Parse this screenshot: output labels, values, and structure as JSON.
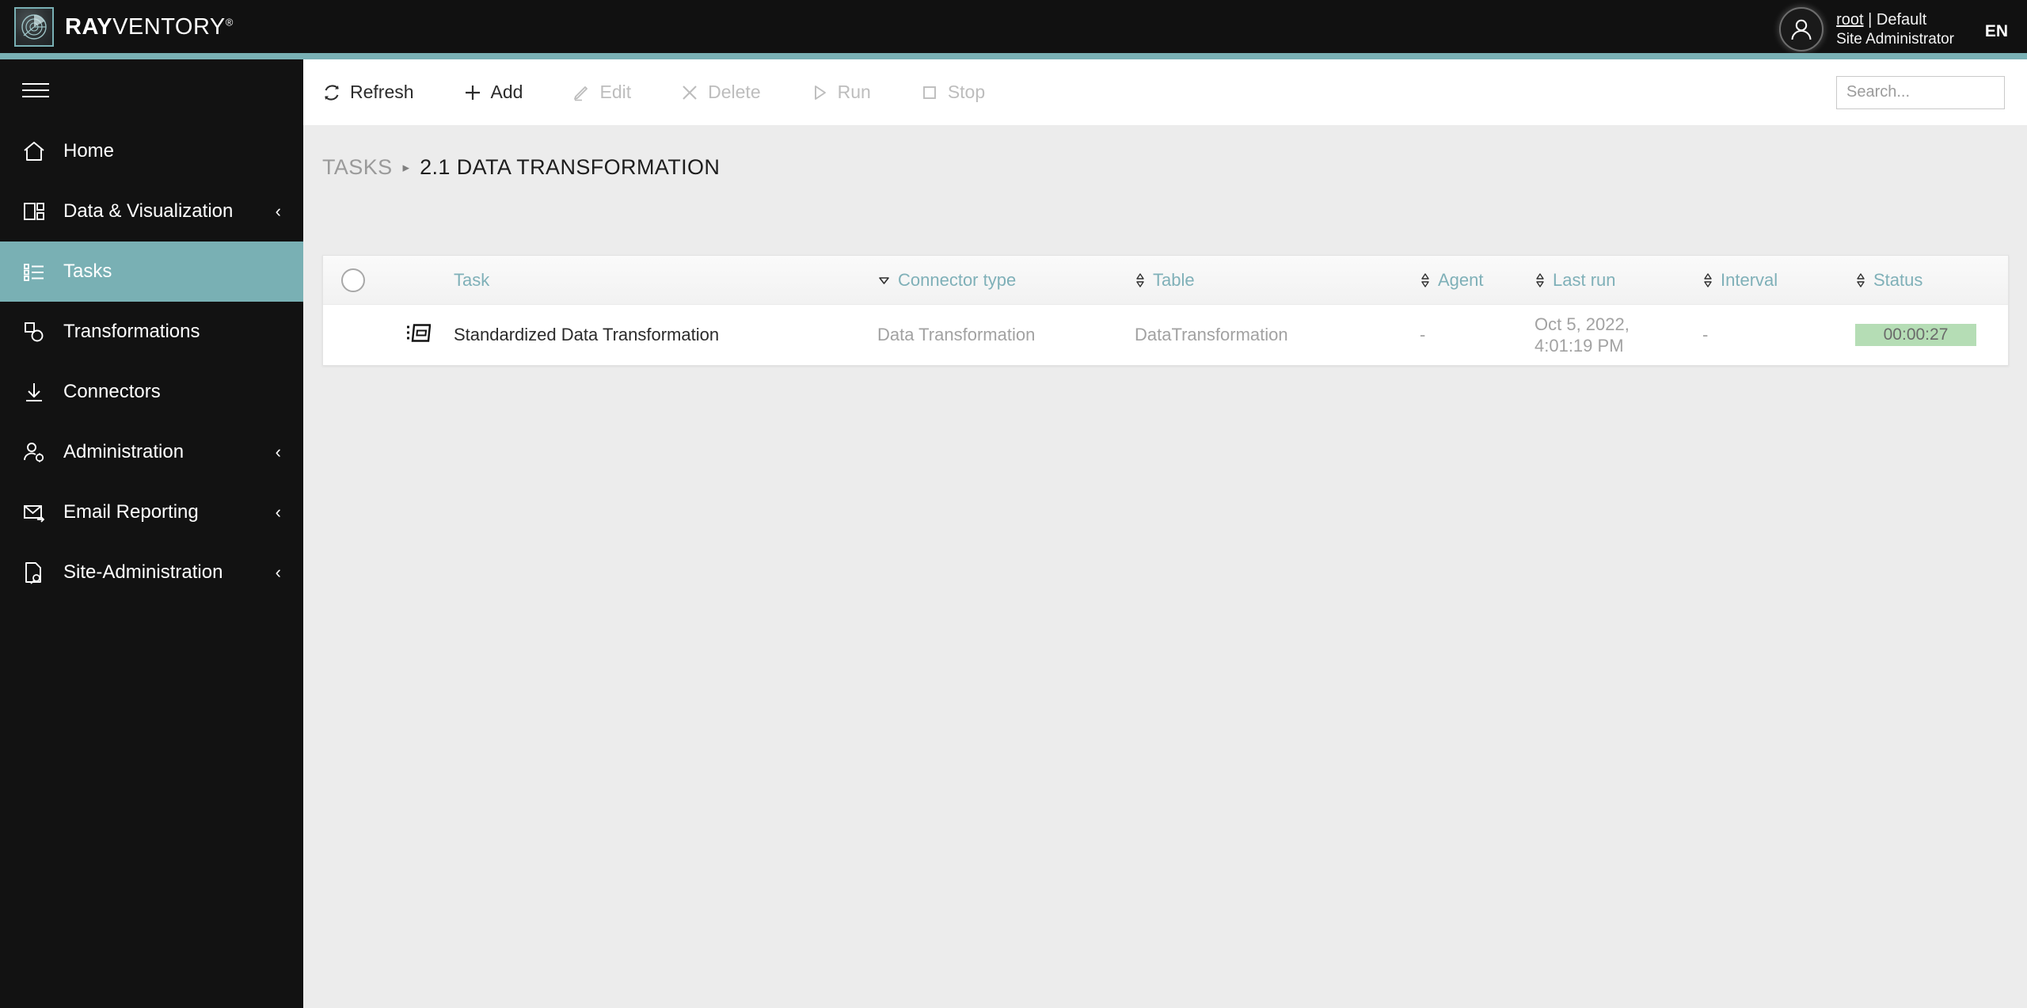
{
  "app": {
    "brand_bold": "RAY",
    "brand_light": "VENTORY",
    "brand_reg": "®",
    "logo_icon": "radar-icon",
    "accent_color": "#79b0b4",
    "topbar_color": "#111111"
  },
  "user": {
    "name": "root",
    "separator": " | ",
    "tenant": "Default",
    "role": "Site Administrator",
    "language": "EN",
    "avatar_icon": "user-avatar-icon"
  },
  "sidebar": {
    "menu_icon": "hamburger-icon",
    "items": [
      {
        "label": "Home",
        "icon": "home-icon",
        "active": false,
        "expandable": false
      },
      {
        "label": "Data & Visualization",
        "icon": "dashboard-icon",
        "active": false,
        "expandable": true,
        "chevron": "‹"
      },
      {
        "label": "Tasks",
        "icon": "list-icon",
        "active": true,
        "expandable": false
      },
      {
        "label": "Transformations",
        "icon": "transform-icon",
        "active": false,
        "expandable": false
      },
      {
        "label": "Connectors",
        "icon": "download-icon",
        "active": false,
        "expandable": false
      },
      {
        "label": "Administration",
        "icon": "user-gear-icon",
        "active": false,
        "expandable": true,
        "chevron": "‹"
      },
      {
        "label": "Email Reporting",
        "icon": "mail-send-icon",
        "active": false,
        "expandable": true,
        "chevron": "‹"
      },
      {
        "label": "Site-Administration",
        "icon": "page-key-icon",
        "active": false,
        "expandable": true,
        "chevron": "‹"
      }
    ]
  },
  "toolbar": {
    "buttons": [
      {
        "label": "Refresh",
        "icon": "refresh-icon",
        "disabled": false
      },
      {
        "label": "Add",
        "icon": "plus-icon",
        "disabled": false
      },
      {
        "label": "Edit",
        "icon": "pencil-icon",
        "disabled": true
      },
      {
        "label": "Delete",
        "icon": "close-x-icon",
        "disabled": true
      },
      {
        "label": "Run",
        "icon": "play-icon",
        "disabled": true
      },
      {
        "label": "Stop",
        "icon": "stop-square-icon",
        "disabled": true
      }
    ]
  },
  "search": {
    "value": "",
    "placeholder": "Search...",
    "icon": "search-icon"
  },
  "breadcrumb": {
    "root": "TASKS",
    "separator": "▸",
    "current": "2.1 DATA TRANSFORMATION"
  },
  "table": {
    "columns": [
      {
        "label": "Task",
        "sort": "none"
      },
      {
        "label": "Connector type",
        "sort": "desc"
      },
      {
        "label": "Table",
        "sort": "none"
      },
      {
        "label": "Agent",
        "sort": "none"
      },
      {
        "label": "Last run",
        "sort": "none"
      },
      {
        "label": "Interval",
        "sort": "none"
      },
      {
        "label": "Status",
        "sort": "none"
      }
    ],
    "rows": [
      {
        "icon": "task-card-icon",
        "task": "Standardized Data Transformation",
        "connector_type": "Data Transformation",
        "table": "DataTransformation",
        "agent": "-",
        "last_run": "Oct 5, 2022, 4:01:19 PM",
        "interval": "-",
        "status": "00:00:27",
        "status_color": "#b5ddb5"
      }
    ]
  }
}
